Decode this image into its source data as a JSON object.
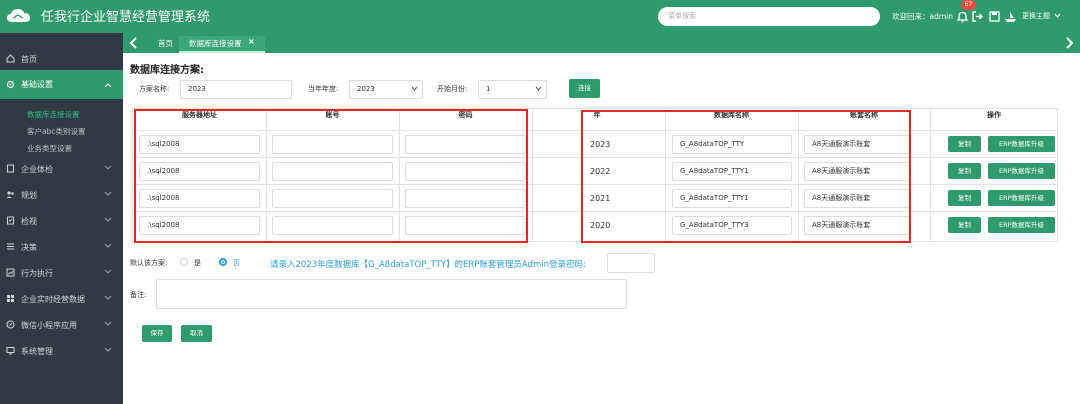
{
  "header": {
    "app_title": "任我行企业智慧经营管理系统",
    "search_placeholder": "菜单搜索",
    "welcome": "欢迎回来：admin",
    "notification_count": "67",
    "theme_label": "更换主题"
  },
  "sidebar": {
    "items": [
      {
        "label": "首页"
      },
      {
        "label": "基础设置"
      },
      {
        "label": "企业体检"
      },
      {
        "label": "规划"
      },
      {
        "label": "检视"
      },
      {
        "label": "决策"
      },
      {
        "label": "行为执行"
      },
      {
        "label": "企业实时经营数据"
      },
      {
        "label": "微信小程序应用"
      },
      {
        "label": "系统管理"
      }
    ],
    "sub_items": [
      {
        "label": "数据库连接设置"
      },
      {
        "label": "客户abc类别设置"
      },
      {
        "label": "业务类型设置"
      }
    ]
  },
  "tabs": {
    "home": "首页",
    "active": "数据库连接设置"
  },
  "form": {
    "section_title": "数据库连接方案:",
    "scheme_name_label": "方案名称:",
    "scheme_name_value": "2023",
    "year_label": "当年年度:",
    "year_value": "2023",
    "month_label": "开始月份:",
    "month_value": "1",
    "connect_button": "连接"
  },
  "table": {
    "headers": {
      "server": "服务器地址",
      "account": "账号",
      "password": "密码",
      "year": "年",
      "db_name": "数据库名称",
      "book_name": "账套名称",
      "ops": "操作"
    },
    "rows": [
      {
        "server": ".\\sql2008",
        "account": "",
        "password": "",
        "year": "2023",
        "db_name": "G_A8dataTOP_TTY",
        "book_name": "A8天通服演示账套",
        "copy": "复制",
        "upgrade": "ERP数据库升级"
      },
      {
        "server": ".\\sql2008",
        "account": "",
        "password": "",
        "year": "2022",
        "db_name": "G_A8dataTOP_TTY1",
        "book_name": "A8天通服演示账套",
        "copy": "复制",
        "upgrade": "ERP数据库升级"
      },
      {
        "server": ".\\sql2008",
        "account": "",
        "password": "",
        "year": "2021",
        "db_name": "G_A8dataTOP_TTY1",
        "book_name": "A8天通服演示账套",
        "copy": "复制",
        "upgrade": "ERP数据库升级"
      },
      {
        "server": ".\\sql2008",
        "account": "",
        "password": "",
        "year": "2020",
        "db_name": "G_A8dataTOP_TTY3",
        "book_name": "A8天通服演示账套",
        "copy": "复制",
        "upgrade": "ERP数据库升级"
      }
    ]
  },
  "bottom": {
    "default_label": "默认该方案:",
    "yes": "是",
    "no": "否",
    "prompt": "请录入2023年度数据库【G_A8dataTOP_TTY】的ERP账套管理员Admin登录密码:",
    "remark_label": "备注:",
    "save_button": "保存",
    "cancel_button": "取消"
  },
  "colors": {
    "brand": "#2f9a6c",
    "sidebar_bg": "#2f3a46",
    "highlight": "#e02828",
    "link": "#2a9fd8"
  }
}
